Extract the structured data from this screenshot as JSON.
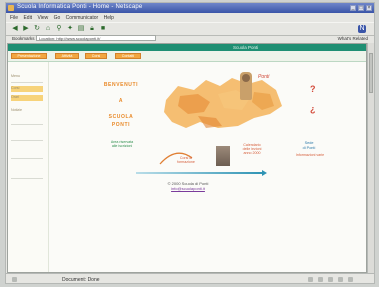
{
  "window": {
    "title": "Scuola Informatica Ponti - Home - Netscape"
  },
  "menu": [
    "File",
    "Edit",
    "View",
    "Go",
    "Communicator",
    "Help"
  ],
  "toolbar": {
    "icons": [
      "back-icon",
      "forward-icon",
      "reload-icon",
      "home-icon",
      "search-icon",
      "guide-icon",
      "print-icon",
      "security-icon",
      "stop-icon"
    ]
  },
  "address": {
    "label": "Bookmarks",
    "url": "Location: http://www.scuolaponti.it/",
    "related": "What's Related"
  },
  "page": {
    "header_right": "Scuola Ponti",
    "nav_tabs": [
      "Presentazione",
      "Attività",
      "Corsi",
      "Contatti"
    ],
    "sidebar_items": [
      "Menu",
      "Corsi",
      "Orari",
      "Notizie"
    ],
    "welcome_lines": [
      "BENVENUTI",
      "A",
      "SCUOLA",
      "PONTI"
    ],
    "left_info": "Area riservata\nalle iscrizioni",
    "center_info": "Corsi di\nformazione",
    "right_center_info": "Calendario\ndelle lezioni\nanno 2000",
    "logo_mark": "Ponti",
    "right_info": "Sede\ndi Ponti",
    "right_info_sub": "Informazioni varie",
    "footer_line": "© 2000 Scuola di Ponti",
    "footer_link": "info@scuolaponti.it"
  },
  "status": {
    "text": "Document: Done"
  },
  "colors": {
    "accent_green": "#1f8f73",
    "orange": "#f2a640",
    "map": "#f3b35a"
  }
}
